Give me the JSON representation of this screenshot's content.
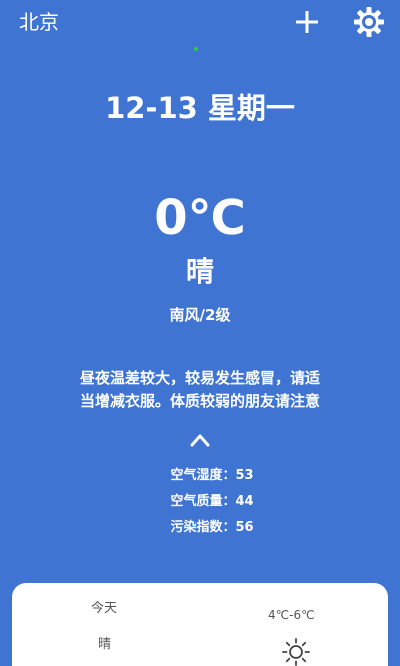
{
  "header": {
    "city": "北京",
    "add_icon": "plus-icon",
    "settings_icon": "gear-icon"
  },
  "main": {
    "date": "12-13 星期一",
    "temperature": "0℃",
    "condition": "晴",
    "wind": "南风/2级",
    "advice_line1": "昼夜温差较大，较易发生感冒，请适",
    "advice_line2": "当增减衣服。体质较弱的朋友请注意",
    "expand_icon": "chevron-up-icon"
  },
  "metrics": {
    "humidity": "空气湿度：53",
    "air_quality": "空气质量：44",
    "pollution": "污染指数：56"
  },
  "forecast": {
    "today_label": "今天",
    "today_condition": "晴",
    "temp_range": "4℃-6℃",
    "weather_icon": "sun-icon"
  },
  "colors": {
    "background": "#3f74d2",
    "card": "#ffffff",
    "indicator": "#2ecc40"
  }
}
